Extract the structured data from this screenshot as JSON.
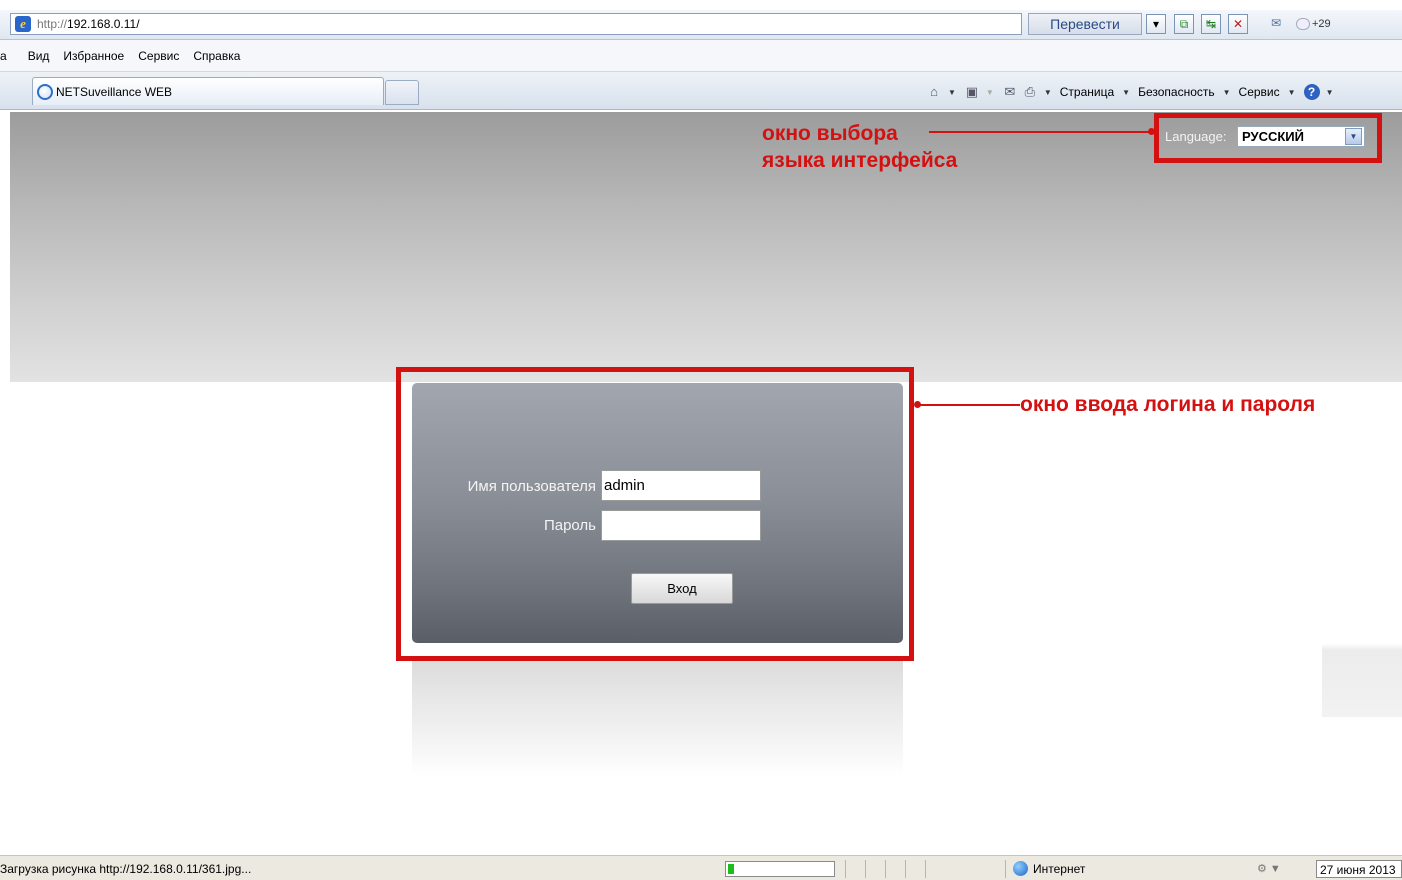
{
  "browser": {
    "url_protocol": "http://",
    "url_host": "192.168.0.11/",
    "translate_label": "Перевести",
    "weather": "+29",
    "menu": [
      "а",
      "Вид",
      "Избранное",
      "Сервис",
      "Справка"
    ],
    "tab_title": "NETSuveillance WEB",
    "commands": {
      "page": "Страница",
      "security": "Безопасность",
      "service": "Сервис"
    }
  },
  "page": {
    "language_label": "Language:",
    "language_value": "РУССКИЙ",
    "username_label": "Имя пользователя",
    "username_value": "admin",
    "password_label": "Пароль",
    "login_button": "Вход"
  },
  "annotations": {
    "language_note_line1": "окно выбора",
    "language_note_line2": "языка интерфейса",
    "login_note": "окно ввода логина и пароля",
    "color": "#d41111"
  },
  "status_bar": {
    "text": "Загрузка рисунка http://192.168.0.11/361.jpg...",
    "progress": 0.06,
    "zone": "Интернет",
    "date": "27 июня 2013"
  }
}
